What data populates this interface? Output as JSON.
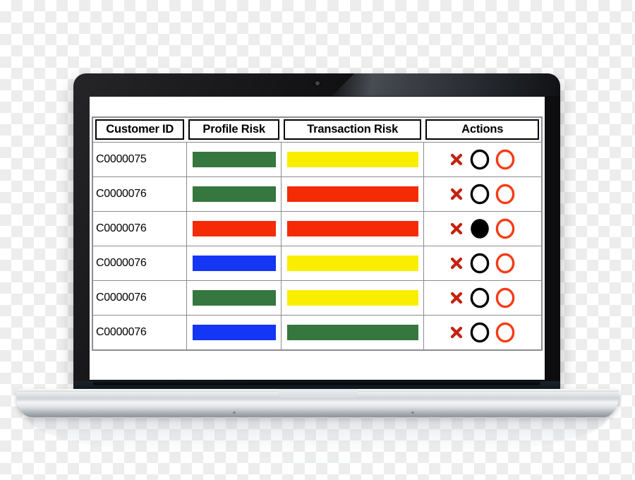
{
  "device": {
    "type": "laptop",
    "bezel_color": "#0d0d0f",
    "base_color": "#d8dbde",
    "webcam_label": "webcam-dot"
  },
  "screen": {
    "background_color": "#ffffff"
  },
  "table": {
    "title": "",
    "border_color": "#8d8b93",
    "columns": [
      {
        "key": "customer_id",
        "label": "Customer ID"
      },
      {
        "key": "profile_risk",
        "label": "Profile Risk"
      },
      {
        "key": "transaction_risk",
        "label": "Transaction Risk"
      },
      {
        "key": "actions",
        "label": "Actions"
      }
    ],
    "risk_colors": {
      "green": "#35773f",
      "yellow": "#faee00",
      "red": "#f52b05",
      "blue": "#1436f5"
    },
    "action_icons": {
      "delete": "x-icon",
      "flag": "circle-outline-icon",
      "escalate": "circle-outline-icon"
    },
    "rows": [
      {
        "customer_id": "C0000075",
        "profile_risk": {
          "level": "green",
          "color": "#35773f"
        },
        "transaction_risk": {
          "level": "yellow",
          "color": "#faee00"
        },
        "actions": {
          "delete": {
            "icon": "x-icon",
            "color": "#c52110"
          },
          "black_circle": {
            "icon": "circle-outline-icon",
            "color": "#000000",
            "filled": false
          },
          "red_circle": {
            "icon": "circle-outline-icon",
            "color": "#f53b16",
            "filled": false
          }
        }
      },
      {
        "customer_id": "C0000076",
        "profile_risk": {
          "level": "green",
          "color": "#35773f"
        },
        "transaction_risk": {
          "level": "red",
          "color": "#f52b05"
        },
        "actions": {
          "delete": {
            "icon": "x-icon",
            "color": "#c52110"
          },
          "black_circle": {
            "icon": "circle-outline-icon",
            "color": "#000000",
            "filled": false
          },
          "red_circle": {
            "icon": "circle-outline-icon",
            "color": "#f53b16",
            "filled": false
          }
        }
      },
      {
        "customer_id": "C0000076",
        "profile_risk": {
          "level": "red",
          "color": "#f52b05"
        },
        "transaction_risk": {
          "level": "red",
          "color": "#f52b05"
        },
        "actions": {
          "delete": {
            "icon": "x-icon",
            "color": "#c52110"
          },
          "black_circle": {
            "icon": "circle-filled-icon",
            "color": "#000000",
            "filled": true
          },
          "red_circle": {
            "icon": "circle-outline-icon",
            "color": "#f53b16",
            "filled": false
          }
        }
      },
      {
        "customer_id": "C0000076",
        "profile_risk": {
          "level": "blue",
          "color": "#1436f5"
        },
        "transaction_risk": {
          "level": "yellow",
          "color": "#faee00"
        },
        "actions": {
          "delete": {
            "icon": "x-icon",
            "color": "#c52110"
          },
          "black_circle": {
            "icon": "circle-outline-icon",
            "color": "#000000",
            "filled": false
          },
          "red_circle": {
            "icon": "circle-outline-icon",
            "color": "#f53b16",
            "filled": false
          }
        }
      },
      {
        "customer_id": "C0000076",
        "profile_risk": {
          "level": "green",
          "color": "#35773f"
        },
        "transaction_risk": {
          "level": "yellow",
          "color": "#faee00"
        },
        "actions": {
          "delete": {
            "icon": "x-icon",
            "color": "#c52110"
          },
          "black_circle": {
            "icon": "circle-outline-icon",
            "color": "#000000",
            "filled": false
          },
          "red_circle": {
            "icon": "circle-outline-icon",
            "color": "#f53b16",
            "filled": false
          }
        }
      },
      {
        "customer_id": "C0000076",
        "profile_risk": {
          "level": "blue",
          "color": "#1436f5"
        },
        "transaction_risk": {
          "level": "green",
          "color": "#35773f"
        },
        "actions": {
          "delete": {
            "icon": "x-icon",
            "color": "#c52110"
          },
          "black_circle": {
            "icon": "circle-outline-icon",
            "color": "#000000",
            "filled": false
          },
          "red_circle": {
            "icon": "circle-outline-icon",
            "color": "#f53b16",
            "filled": false
          }
        }
      }
    ]
  }
}
